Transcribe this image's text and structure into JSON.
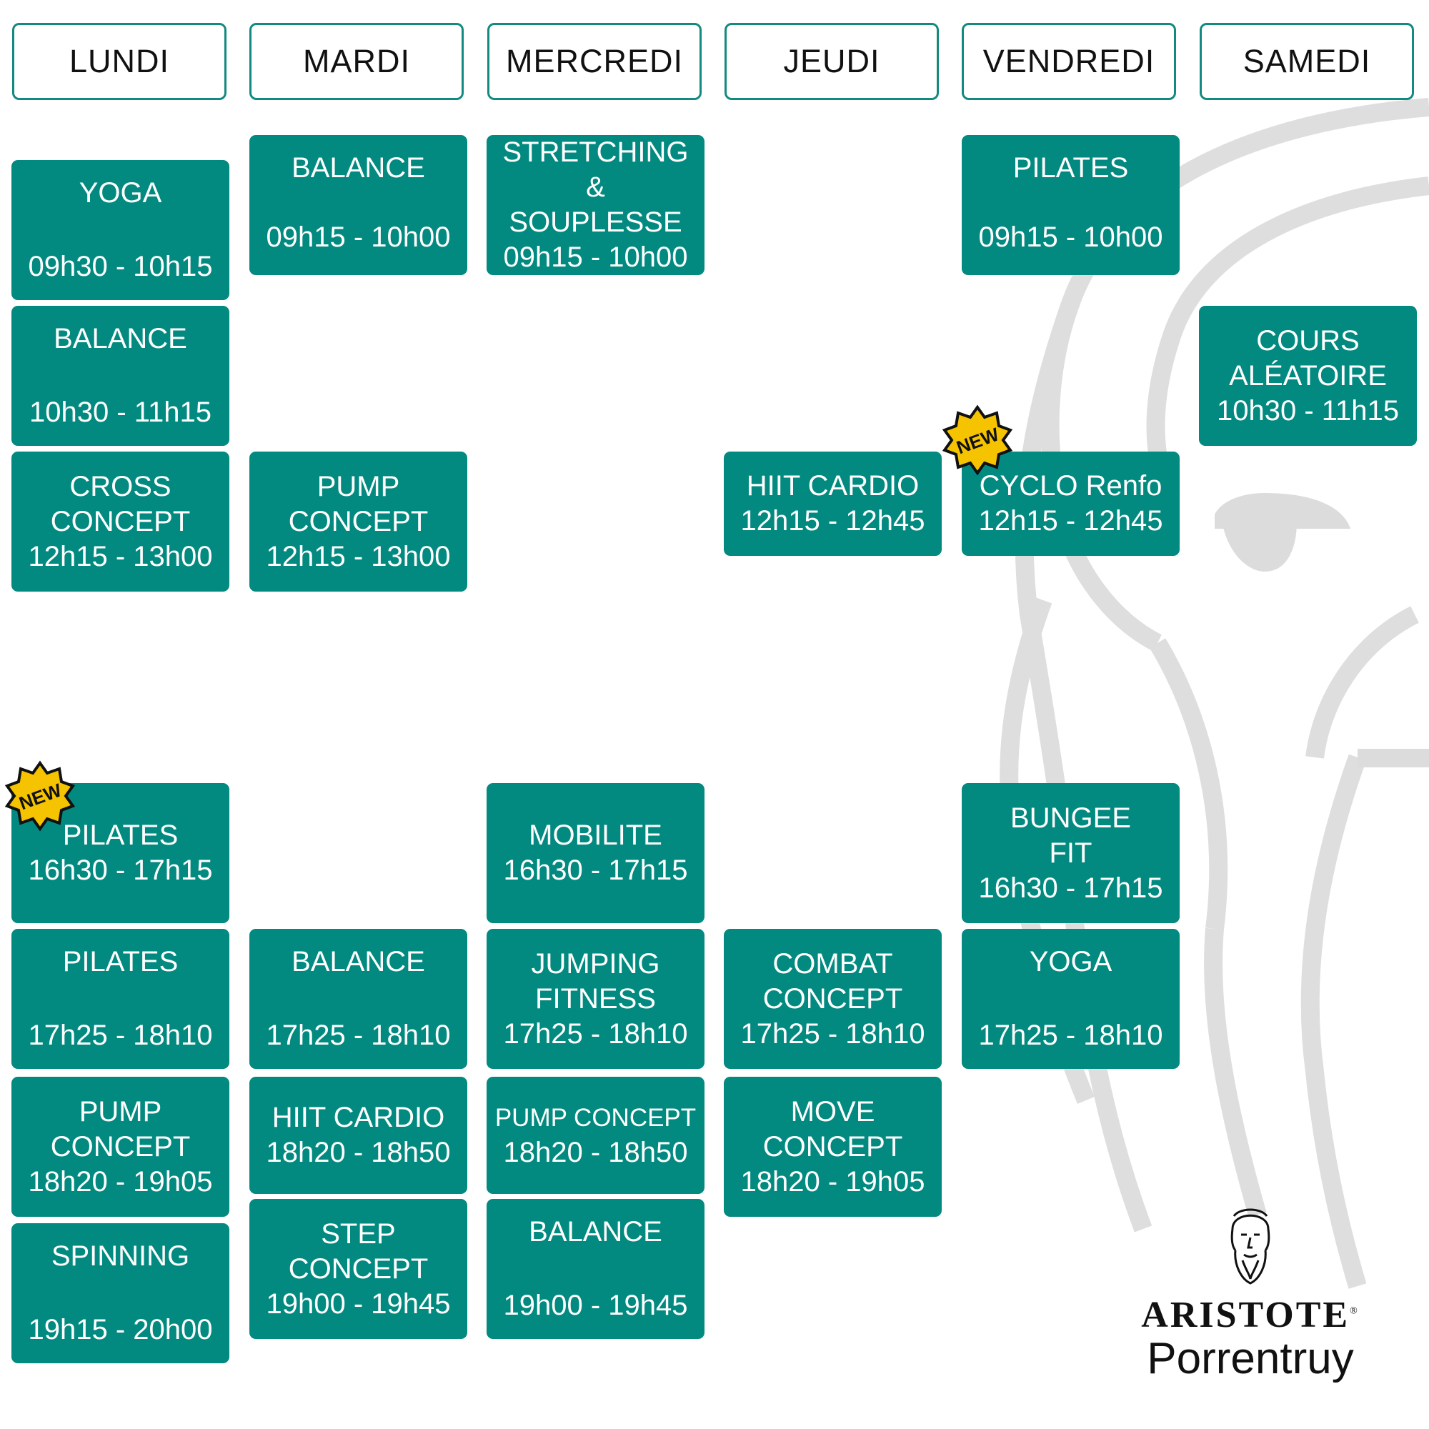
{
  "days": [
    "LUNDI",
    "MARDI",
    "MERCREDI",
    "JEUDI",
    "VENDREDI",
    "SAMEDI"
  ],
  "classes": {
    "lundi_yoga": {
      "name": "YOGA",
      "time": "09h30 - 10h15"
    },
    "lundi_balance": {
      "name": "BALANCE",
      "time": "10h30 - 11h15"
    },
    "lundi_cross": {
      "name": "CROSS\nCONCEPT",
      "time": "12h15 - 13h00"
    },
    "lundi_pilates_new": {
      "name": "PILATES",
      "time": "16h30 - 17h15"
    },
    "lundi_pilates": {
      "name": "PILATES",
      "time": "17h25 - 18h10"
    },
    "lundi_pump": {
      "name": "PUMP\nCONCEPT",
      "time": "18h20 - 19h05"
    },
    "lundi_spinning": {
      "name": "SPINNING",
      "time": "19h15 - 20h00"
    },
    "mardi_balance_am": {
      "name": "BALANCE",
      "time": "09h15 - 10h00"
    },
    "mardi_pump": {
      "name": "PUMP\nCONCEPT",
      "time": "12h15 - 13h00"
    },
    "mardi_balance_pm": {
      "name": "BALANCE",
      "time": "17h25 - 18h10"
    },
    "mardi_hiit": {
      "name": "HIIT CARDIO",
      "time": "18h20 - 18h50"
    },
    "mardi_step": {
      "name": "STEP\nCONCEPT",
      "time": "19h00 - 19h45"
    },
    "mercredi_stretching": {
      "name": "STRETCHING &\nSOUPLESSE",
      "time": "09h15 - 10h00"
    },
    "mercredi_mobilite": {
      "name": "MOBILITE",
      "time": "16h30 - 17h15"
    },
    "mercredi_jumping": {
      "name": "JUMPING\nFITNESS",
      "time": "17h25 - 18h10"
    },
    "mercredi_pump": {
      "name": "PUMP CONCEPT",
      "time": "18h20 - 18h50"
    },
    "mercredi_balance": {
      "name": "BALANCE",
      "time": "19h00 - 19h45"
    },
    "jeudi_hiit": {
      "name": "HIIT CARDIO",
      "time": "12h15 - 12h45"
    },
    "jeudi_combat": {
      "name": "COMBAT\nCONCEPT",
      "time": "17h25 - 18h10"
    },
    "jeudi_move": {
      "name": "MOVE\nCONCEPT",
      "time": "18h20 - 19h05"
    },
    "vendredi_pilates": {
      "name": "PILATES",
      "time": "09h15 - 10h00"
    },
    "vendredi_cyclo": {
      "name": "CYCLO Renfo",
      "time": "12h15 - 12h45"
    },
    "vendredi_bungee": {
      "name": "BUNGEE\nFIT",
      "time": "16h30 - 17h15"
    },
    "vendredi_yoga": {
      "name": "YOGA",
      "time": "17h25 - 18h10"
    },
    "samedi_cours": {
      "name": "COURS\nALÉATOIRE",
      "time": "10h30 - 11h15"
    }
  },
  "badge_text": "NEW",
  "logo": {
    "brand": "ARISTOTE",
    "registered": "®",
    "city": "Porrentruy"
  },
  "colors": {
    "card": "#028a80",
    "header_border": "#138a80",
    "badge": "#f5c400",
    "watermark": "#dadada"
  }
}
